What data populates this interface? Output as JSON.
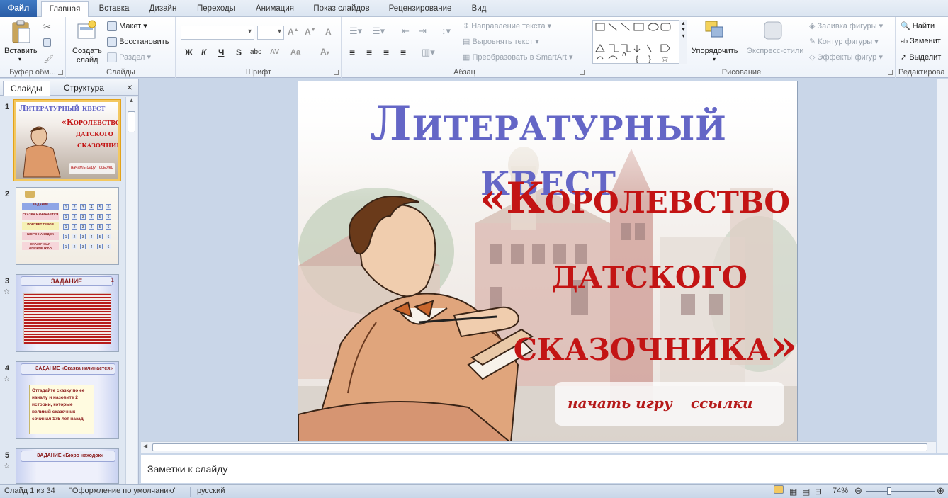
{
  "tabs": {
    "file": "Файл",
    "items": [
      "Главная",
      "Вставка",
      "Дизайн",
      "Переходы",
      "Анимация",
      "Показ слайдов",
      "Рецензирование",
      "Вид"
    ],
    "active": "Главная"
  },
  "ribbon": {
    "clipboard": {
      "paste": "Вставить",
      "label": "Буфер обм..."
    },
    "slides": {
      "new_slide_1": "Создать",
      "new_slide_2": "слайд",
      "layout": "Макет",
      "reset": "Восстановить",
      "section": "Раздел",
      "label": "Слайды"
    },
    "font": {
      "label": "Шрифт",
      "bold": "Ж",
      "italic": "К",
      "underline": "Ч",
      "strike": "S",
      "abc": "abc",
      "av": "AV",
      "aa": "Aa"
    },
    "paragraph": {
      "text_direction": "Направление текста",
      "align_text": "Выровнять текст",
      "smartart": "Преобразовать в SmartArt",
      "label": "Абзац"
    },
    "drawing": {
      "arrange": "Упорядочить",
      "quick_styles": "Экспресс-стили",
      "fill": "Заливка фигуры",
      "outline": "Контур фигуры",
      "effects": "Эффекты фигур",
      "label": "Рисование"
    },
    "editing": {
      "find": "Найти",
      "replace": "Заменит",
      "select": "Выделит",
      "label": "Редактирова"
    }
  },
  "left_panel": {
    "tab_slides": "Слайды",
    "tab_outline": "Структура",
    "close": "×",
    "thumbs": [
      {
        "num": "1",
        "star": ""
      },
      {
        "num": "2",
        "star": ""
      },
      {
        "num": "3",
        "star": "☆"
      },
      {
        "num": "4",
        "star": "☆"
      },
      {
        "num": "5",
        "star": "☆"
      }
    ],
    "thumb1_title": "Литературный квест",
    "thumb1_sub_1": "«Королевство",
    "thumb1_sub_2": "датского",
    "thumb1_sub_3": "сказочника»",
    "thumb1_btn_start": "начать игру",
    "thumb1_btn_links": "ссылки",
    "thumb2_rows": [
      "ЗАДАНИЕ",
      "СКАЗКА НАЧИНАЕТСЯ",
      "ПОРТРЕТ ГЕРОЯ",
      "БЮРО НАХОДОК",
      "СКАЗОЧНАЯ АРИФМЕТИКА"
    ],
    "thumb2_cells": [
      "1",
      "2",
      "3",
      "4",
      "5",
      "6"
    ],
    "thumb3_title": "ЗАДАНИЕ",
    "thumb3_page": "1",
    "thumb4_title": "ЗАДАНИЕ «Сказка начинается»",
    "thumb4_text": "Отгадайте сказку по ее началу и назовите 2 истории, которые великий сказочник сочинил 175 лет назад",
    "thumb5_title": "ЗАДАНИЕ «Бюро находок»"
  },
  "slide": {
    "title": "Литературный квест",
    "sub_1": "«Королевство",
    "sub_2": "датского",
    "sub_3": "сказочника»",
    "btn_start": "начать игру",
    "btn_links": "ссылки"
  },
  "notes": {
    "placeholder": "Заметки к слайду"
  },
  "status": {
    "slide_counter": "Слайд 1 из 34",
    "theme": "\"Оформление по умолчанию\"",
    "language": "русский",
    "zoom": "74%"
  },
  "colors": {
    "title": "#6466c6",
    "subtitle": "#c31414",
    "file_tab": "#2f68b4",
    "selection": "#f3c861"
  }
}
